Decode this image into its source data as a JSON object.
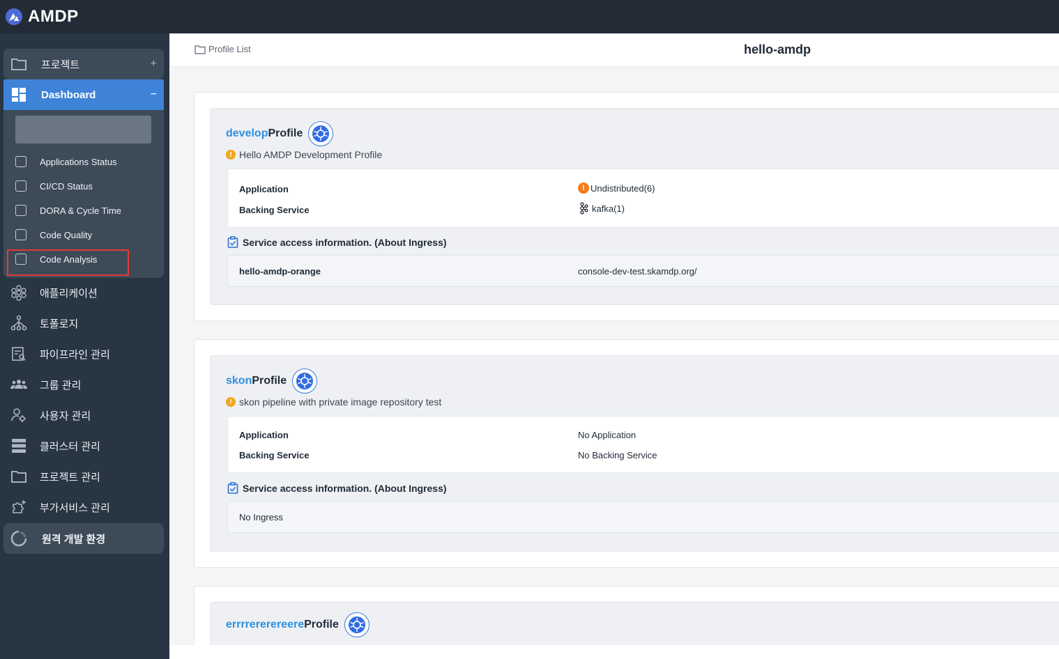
{
  "app": {
    "name": "AMDP"
  },
  "sidebar": {
    "project": {
      "label": "프로젝트",
      "action": "+"
    },
    "dashboard": {
      "label": "Dashboard",
      "action": "−"
    },
    "dashboard_items": [
      {
        "label": "Applications Status"
      },
      {
        "label": "CI/CD Status"
      },
      {
        "label": "DORA & Cycle Time"
      },
      {
        "label": "Code Quality"
      },
      {
        "label": "Code Analysis"
      }
    ],
    "menu": [
      {
        "label": "애플리케이션",
        "icon": "application-icon"
      },
      {
        "label": "토폴로지",
        "icon": "topology-icon"
      },
      {
        "label": "파이프라인 관리",
        "icon": "pipeline-icon"
      },
      {
        "label": "그룹 관리",
        "icon": "group-icon"
      },
      {
        "label": "사용자 관리",
        "icon": "user-settings-icon"
      },
      {
        "label": "클러스터 관리",
        "icon": "cluster-icon"
      },
      {
        "label": "프로젝트 관리",
        "icon": "folder-icon"
      },
      {
        "label": "부가서비스 관리",
        "icon": "addon-icon"
      }
    ],
    "remote": {
      "label": "원격 개발 환경",
      "icon": "remote-dev-icon"
    }
  },
  "header": {
    "breadcrumb": "Profile List",
    "title": "hello-amdp"
  },
  "profiles": [
    {
      "name": "develop",
      "suffix": "Profile",
      "description": "Hello AMDP Development Profile",
      "application_label": "Application",
      "application_value": "Undistributed(6)",
      "backing_label": "Backing Service",
      "backing_value": "kafka(1)",
      "service_title": "Service access information. (About Ingress)",
      "ingress_name": "hello-amdp-orange",
      "ingress_host": "console-dev-test.skamdp.org/"
    },
    {
      "name": "skon",
      "suffix": "Profile",
      "description": "skon pipeline with private image repository test",
      "application_label": "Application",
      "application_value": "No Application",
      "backing_label": "Backing Service",
      "backing_value": "No Backing Service",
      "service_title": "Service access information. (About Ingress)",
      "ingress_empty": "No Ingress"
    },
    {
      "name": "errrrererereere",
      "suffix": "Profile"
    }
  ],
  "colors": {
    "topbar": "#222b36",
    "sidebar": "#283543",
    "accent": "#3f83d8",
    "profile_name": "#2e8fe0",
    "warning": "#f0a81c",
    "undistributed": "#f57c1f",
    "highlight": "#e53935"
  }
}
